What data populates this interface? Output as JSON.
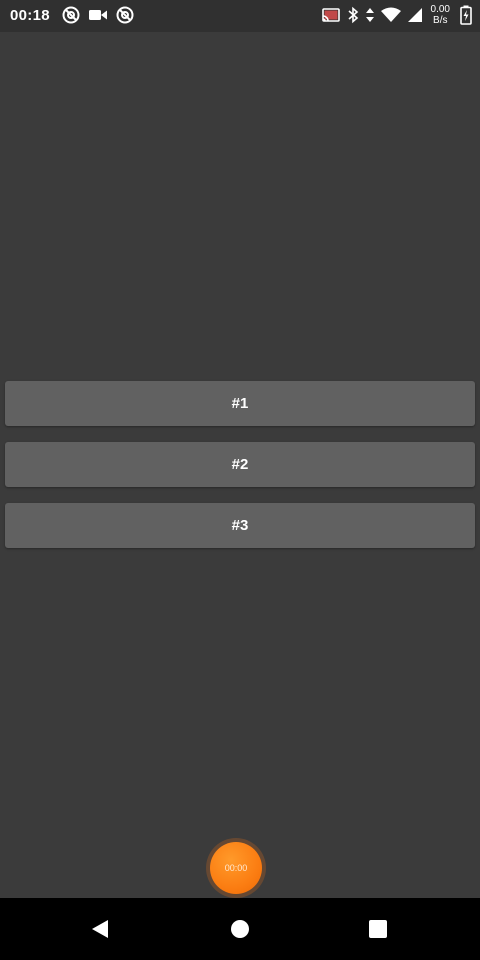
{
  "status_bar": {
    "time": "00:18",
    "net_speed_value": "0.00",
    "net_speed_unit": "B/s",
    "left_icons": [
      "at-sign-icon",
      "video-camera-icon",
      "at-sign-icon"
    ],
    "right_icons": [
      "cast-icon",
      "bluetooth-icon",
      "data-arrows-icon",
      "wifi-icon",
      "signal-icon",
      "battery-charging-icon"
    ]
  },
  "items": [
    {
      "label": "#1"
    },
    {
      "label": "#2"
    },
    {
      "label": "#3"
    }
  ],
  "timer": {
    "label": "00:00",
    "color": "#fb7d12"
  },
  "nav": {
    "buttons": [
      "back-icon",
      "home-icon",
      "recents-icon"
    ]
  },
  "colors": {
    "background": "#3b3b3b",
    "button": "#616161",
    "status_bar": "#303030",
    "nav_bar": "#000000"
  }
}
